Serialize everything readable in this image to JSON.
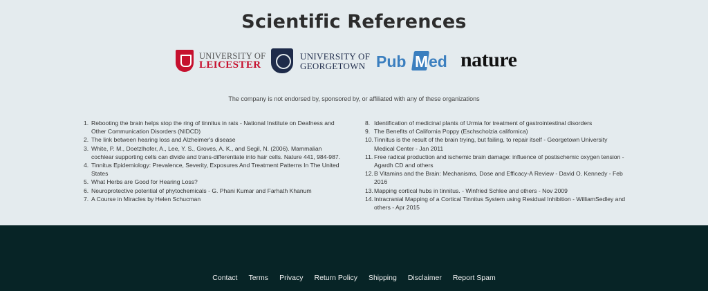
{
  "section": {
    "title": "Scientific References",
    "disclaimer": "The company is not endorsed by, sponsored by, or affiliated with any of these organizations"
  },
  "logos": {
    "leicester": {
      "line1": "UNIVERSITY OF",
      "line2": "LEICESTER"
    },
    "georgetown": {
      "line1": "UNIVERSITY OF",
      "line2": "GEORGETOWN"
    },
    "pubmed": {
      "part1": "Pub",
      "part2": "M",
      "part3": "ed"
    },
    "nature": {
      "text": "nature"
    }
  },
  "references_left": [
    {
      "num": "1.",
      "text": "Rebooting the brain helps stop the ring of tinnitus in rats - National Institute on Deafness and Other Communication Disorders (NIDCD)"
    },
    {
      "num": "2.",
      "text": "The link between hearing loss and Alzheimer's disease"
    },
    {
      "num": "3.",
      "text": "White, P. M., Doetzlhofer, A., Lee, Y. S., Groves, A. K., and Segil, N. (2006). Mammalian cochlear supporting cells can divide and trans-differentiate into hair cells. Nature 441, 984-987."
    },
    {
      "num": "4.",
      "text": "Tinnitus Epidemiology: Prevalence, Severity, Exposures And Treatment Patterns In The United States"
    },
    {
      "num": "5.",
      "text": "What Herbs are Good for Hearing Loss?"
    },
    {
      "num": "6.",
      "text": "Neuroprotective potential of phytochemicals - G. Phani Kumar and Farhath Khanum"
    },
    {
      "num": "7.",
      "text": "A Course in Miracles by Helen Schucman"
    }
  ],
  "references_right": [
    {
      "num": "8.",
      "text": "Identification of medicinal plants of Urmia for treatment of gastrointestinal disorders"
    },
    {
      "num": "9.",
      "text": "The Benefits of California Poppy (Eschscholzia californica)"
    },
    {
      "num": "10.",
      "text": "Tinnitus is the result of the brain trying, but failing, to repair itself - Georgetown University Medical Center - Jan 2011"
    },
    {
      "num": "11.",
      "text": "Free radical production and ischemic brain damage: influence of postischemic oxygen tension - Agardh CD and others"
    },
    {
      "num": "12.",
      "text": "B Vitamins and the Brain: Mechanisms, Dose and Efficacy-A Review - David O. Kennedy - Feb 2016"
    },
    {
      "num": "13.",
      "text": "Mapping cortical hubs in tinnitus. - Winfried Schlee and others - Nov 2009"
    },
    {
      "num": "14.",
      "text": "Intracranial Mapping of a Cortical Tinnitus System using Residual Inhibition - WilliamSedley and others - Apr 2015"
    }
  ],
  "footer": {
    "links": [
      "Contact",
      "Terms",
      "Privacy",
      "Return Policy",
      "Shipping",
      "Disclaimer",
      "Report Spam"
    ]
  }
}
